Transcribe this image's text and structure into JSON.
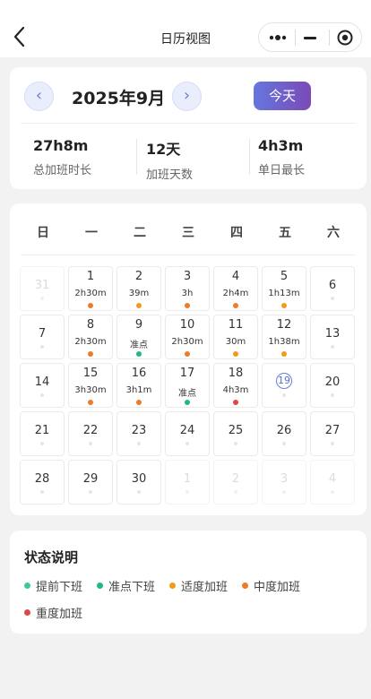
{
  "navbar": {
    "title": "日历视图"
  },
  "header": {
    "month_title": "2025年9月",
    "prev_arrow": "‹",
    "next_arrow": "›",
    "today_label": "今天",
    "stats": [
      {
        "value": "27h8m",
        "label": "总加班时长"
      },
      {
        "value": "12天",
        "label": "加班天数"
      },
      {
        "value": "4h3m",
        "label": "单日最长"
      }
    ]
  },
  "calendar": {
    "weekdays": [
      "日",
      "一",
      "二",
      "三",
      "四",
      "五",
      "六"
    ],
    "days": [
      {
        "day": "31",
        "hours": "",
        "status": "",
        "muted": true
      },
      {
        "day": "1",
        "hours": "2h30m",
        "status": "moderate"
      },
      {
        "day": "2",
        "hours": "39m",
        "status": "light"
      },
      {
        "day": "3",
        "hours": "3h",
        "status": "moderate"
      },
      {
        "day": "4",
        "hours": "2h4m",
        "status": "moderate"
      },
      {
        "day": "5",
        "hours": "1h13m",
        "status": "light"
      },
      {
        "day": "6",
        "hours": "",
        "status": ""
      },
      {
        "day": "7",
        "hours": "",
        "status": ""
      },
      {
        "day": "8",
        "hours": "2h30m",
        "status": "moderate"
      },
      {
        "day": "9",
        "hours": "准点",
        "status": "ontime"
      },
      {
        "day": "10",
        "hours": "2h30m",
        "status": "moderate"
      },
      {
        "day": "11",
        "hours": "30m",
        "status": "light"
      },
      {
        "day": "12",
        "hours": "1h38m",
        "status": "light"
      },
      {
        "day": "13",
        "hours": "",
        "status": ""
      },
      {
        "day": "14",
        "hours": "",
        "status": ""
      },
      {
        "day": "15",
        "hours": "3h30m",
        "status": "moderate"
      },
      {
        "day": "16",
        "hours": "3h1m",
        "status": "moderate"
      },
      {
        "day": "17",
        "hours": "准点",
        "status": "ontime"
      },
      {
        "day": "18",
        "hours": "4h3m",
        "status": "heavy"
      },
      {
        "day": "19",
        "hours": "",
        "status": "",
        "today": true
      },
      {
        "day": "20",
        "hours": "",
        "status": ""
      },
      {
        "day": "21",
        "hours": "",
        "status": ""
      },
      {
        "day": "22",
        "hours": "",
        "status": ""
      },
      {
        "day": "23",
        "hours": "",
        "status": ""
      },
      {
        "day": "24",
        "hours": "",
        "status": ""
      },
      {
        "day": "25",
        "hours": "",
        "status": ""
      },
      {
        "day": "26",
        "hours": "",
        "status": ""
      },
      {
        "day": "27",
        "hours": "",
        "status": ""
      },
      {
        "day": "28",
        "hours": "",
        "status": ""
      },
      {
        "day": "29",
        "hours": "",
        "status": ""
      },
      {
        "day": "30",
        "hours": "",
        "status": ""
      },
      {
        "day": "1",
        "hours": "",
        "status": "",
        "muted": true
      },
      {
        "day": "2",
        "hours": "",
        "status": "",
        "muted": true
      },
      {
        "day": "3",
        "hours": "",
        "status": "",
        "muted": true
      },
      {
        "day": "4",
        "hours": "",
        "status": "",
        "muted": true
      }
    ]
  },
  "legend": {
    "title": "状态说明",
    "items": [
      {
        "label": "提前下班",
        "color": "#3ec99a"
      },
      {
        "label": "准点下班",
        "color": "#1fb88a"
      },
      {
        "label": "适度加班",
        "color": "#f09c1a"
      },
      {
        "label": "中度加班",
        "color": "#ee7a2c"
      },
      {
        "label": "重度加班",
        "color": "#e04848"
      }
    ]
  },
  "status_colors": {
    "ontime": "#1fb88a",
    "light": "#f09c1a",
    "moderate": "#ee7a2c",
    "heavy": "#e04848"
  }
}
